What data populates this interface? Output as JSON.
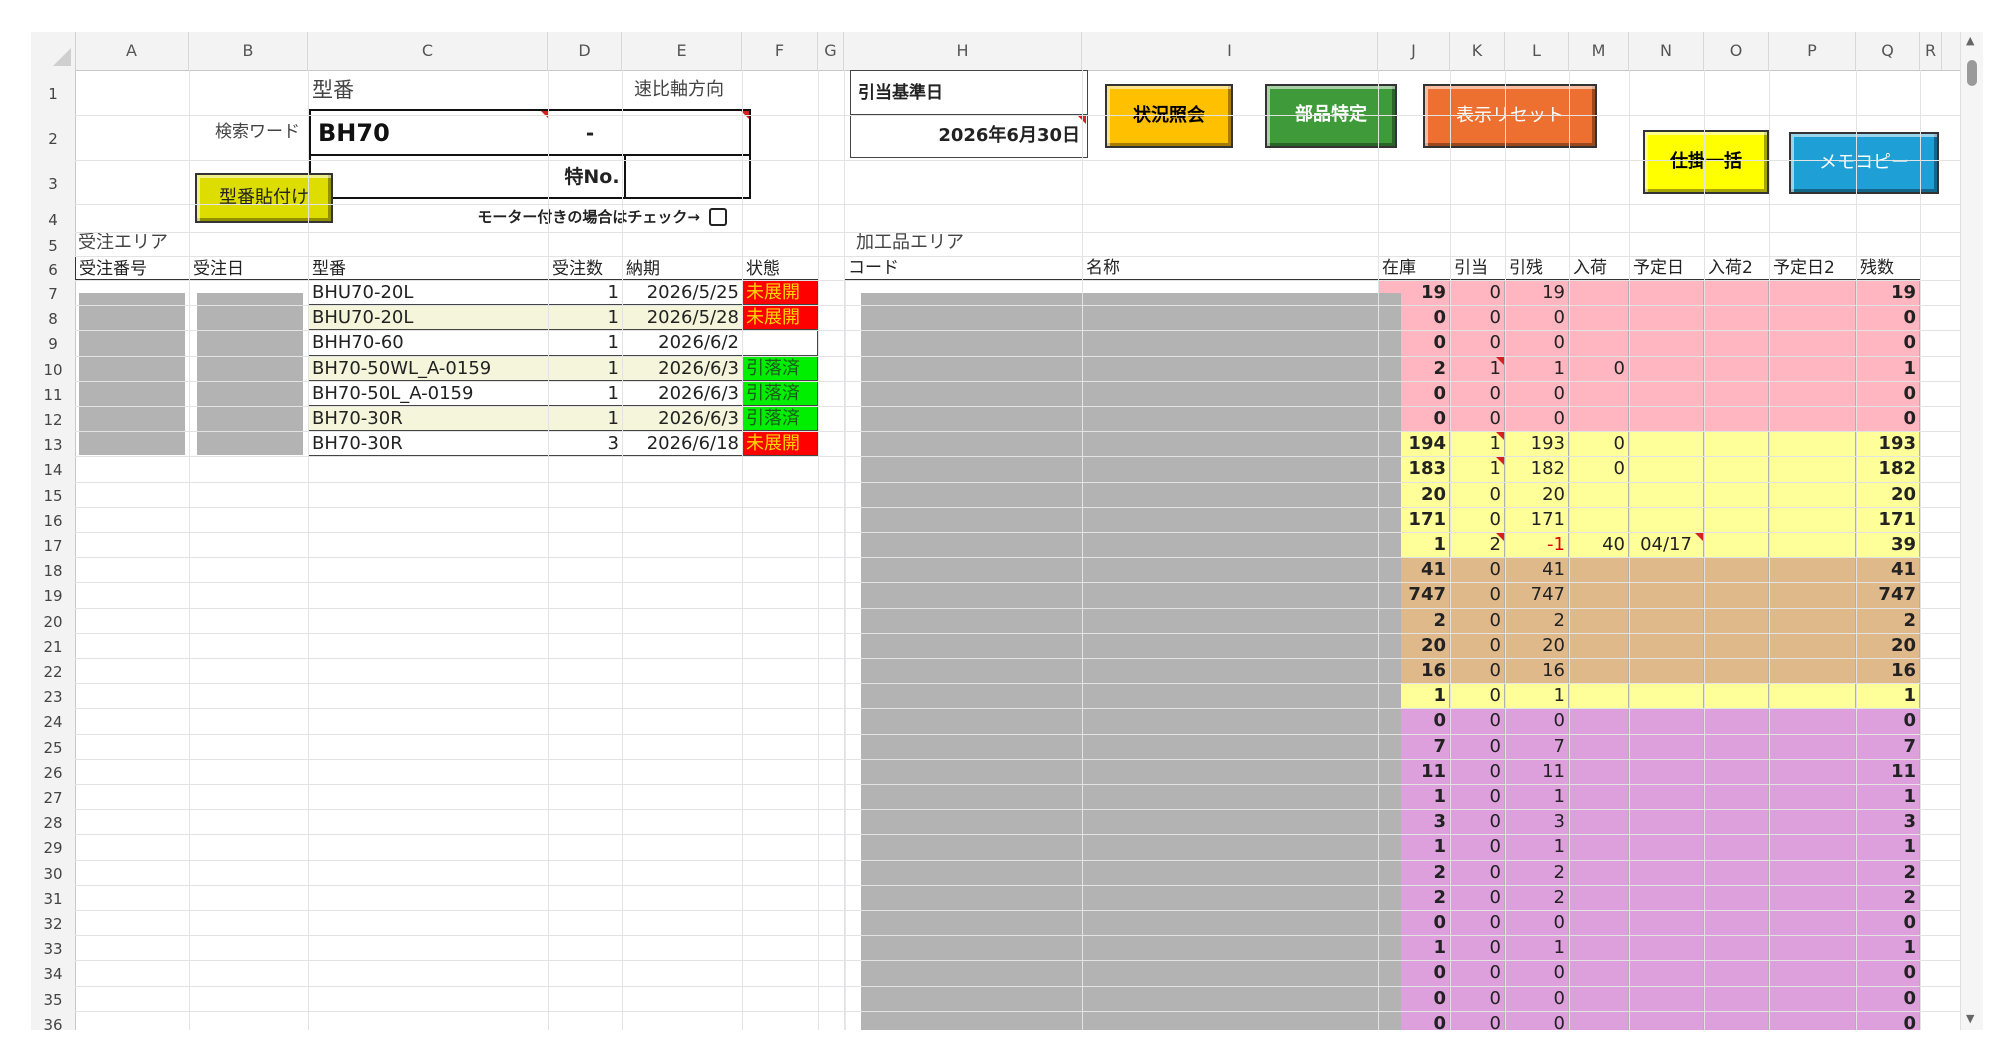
{
  "columns": [
    "A",
    "B",
    "C",
    "D",
    "E",
    "F",
    "G",
    "H",
    "I",
    "J",
    "K",
    "L",
    "M",
    "N",
    "O",
    "P",
    "Q",
    "R"
  ],
  "rows": [
    "1",
    "2",
    "3",
    "4",
    "5",
    "6",
    "7",
    "8",
    "9",
    "10",
    "11",
    "12",
    "13",
    "14",
    "15",
    "16",
    "17",
    "18",
    "19",
    "20",
    "21",
    "22",
    "23",
    "24",
    "25",
    "26",
    "27",
    "28",
    "29",
    "30",
    "31",
    "32",
    "33",
    "34",
    "35",
    "36"
  ],
  "labels": {
    "model_label": "型番",
    "ratio_axis_label": "速比軸方向",
    "search_word_label": "検索ワード",
    "search_value": "BH70",
    "dash": "-",
    "special_no_label": "特No.",
    "motor_check_label": "モーター付きの場合はチェック→",
    "order_area": "受注エリア",
    "processed_area": "加工品エリア",
    "ref_date_label": "引当基準日",
    "ref_date_value": "2026年6月30日"
  },
  "buttons": {
    "paste_model": "型番貼付け",
    "status_inquiry": "状況照会",
    "parts_identify": "部品特定",
    "reset_display": "表示リセット",
    "wip_batch": "仕掛一括",
    "memo_copy": "メモコピー"
  },
  "colors": {
    "unopened": "#ff0000",
    "allocated": "#00ee00",
    "pink": "#ffb6c1",
    "yellow": "#ffff99",
    "tan": "#e0b98a",
    "purple": "#dda0dd",
    "band": "#f5f5dc"
  },
  "order_headers": [
    "受注番号",
    "受注日",
    "型番",
    "受注数",
    "納期",
    "状態"
  ],
  "order_rows": [
    {
      "model": "BHU70-20L",
      "qty": "1",
      "due": "2026/5/25",
      "status": "未展開",
      "kind": "red"
    },
    {
      "model": "BHU70-20L",
      "qty": "1",
      "due": "2026/5/28",
      "status": "未展開",
      "kind": "red"
    },
    {
      "model": "BHH70-60",
      "qty": "1",
      "due": "2026/6/2",
      "status": "",
      "kind": "none"
    },
    {
      "model": "BH70-50WL_A-0159",
      "qty": "1",
      "due": "2026/6/3",
      "status": "引落済",
      "kind": "green"
    },
    {
      "model": "BH70-50L_A-0159",
      "qty": "1",
      "due": "2026/6/3",
      "status": "引落済",
      "kind": "green"
    },
    {
      "model": "BH70-30R",
      "qty": "1",
      "due": "2026/6/3",
      "status": "引落済",
      "kind": "green"
    },
    {
      "model": "BH70-30R",
      "qty": "3",
      "due": "2026/6/18",
      "status": "未展開",
      "kind": "red"
    }
  ],
  "stock_headers": [
    "コード",
    "名称",
    "在庫",
    "引当",
    "引残",
    "入荷",
    "予定日",
    "入荷2",
    "予定日2",
    "残数"
  ],
  "stock_rows": [
    {
      "stock": "19",
      "alloc": "0",
      "remain": "19",
      "arrival": "",
      "plan": "",
      "arrival2": "",
      "plan2": "",
      "balance": "19",
      "color": "pink"
    },
    {
      "stock": "0",
      "alloc": "0",
      "remain": "0",
      "arrival": "",
      "plan": "",
      "arrival2": "",
      "plan2": "",
      "balance": "0",
      "color": "pink"
    },
    {
      "stock": "0",
      "alloc": "0",
      "remain": "0",
      "arrival": "",
      "plan": "",
      "arrival2": "",
      "plan2": "",
      "balance": "0",
      "color": "pink"
    },
    {
      "stock": "2",
      "alloc": "1",
      "remain": "1",
      "arrival": "0",
      "plan": "",
      "arrival2": "",
      "plan2": "",
      "balance": "1",
      "color": "pink"
    },
    {
      "stock": "0",
      "alloc": "0",
      "remain": "0",
      "arrival": "",
      "plan": "",
      "arrival2": "",
      "plan2": "",
      "balance": "0",
      "color": "pink"
    },
    {
      "stock": "0",
      "alloc": "0",
      "remain": "0",
      "arrival": "",
      "plan": "",
      "arrival2": "",
      "plan2": "",
      "balance": "0",
      "color": "pink"
    },
    {
      "stock": "194",
      "alloc": "1",
      "remain": "193",
      "arrival": "0",
      "plan": "",
      "arrival2": "",
      "plan2": "",
      "balance": "193",
      "color": "yellow"
    },
    {
      "stock": "183",
      "alloc": "1",
      "remain": "182",
      "arrival": "0",
      "plan": "",
      "arrival2": "",
      "plan2": "",
      "balance": "182",
      "color": "yellow"
    },
    {
      "stock": "20",
      "alloc": "0",
      "remain": "20",
      "arrival": "",
      "plan": "",
      "arrival2": "",
      "plan2": "",
      "balance": "20",
      "color": "yellow"
    },
    {
      "stock": "171",
      "alloc": "0",
      "remain": "171",
      "arrival": "",
      "plan": "",
      "arrival2": "",
      "plan2": "",
      "balance": "171",
      "color": "yellow"
    },
    {
      "stock": "1",
      "alloc": "2",
      "remain": "-1",
      "arrival": "40",
      "plan": "04/17",
      "arrival2": "",
      "plan2": "",
      "balance": "39",
      "color": "yellow"
    },
    {
      "stock": "41",
      "alloc": "0",
      "remain": "41",
      "arrival": "",
      "plan": "",
      "arrival2": "",
      "plan2": "",
      "balance": "41",
      "color": "tan"
    },
    {
      "stock": "747",
      "alloc": "0",
      "remain": "747",
      "arrival": "",
      "plan": "",
      "arrival2": "",
      "plan2": "",
      "balance": "747",
      "color": "tan"
    },
    {
      "stock": "2",
      "alloc": "0",
      "remain": "2",
      "arrival": "",
      "plan": "",
      "arrival2": "",
      "plan2": "",
      "balance": "2",
      "color": "tan"
    },
    {
      "stock": "20",
      "alloc": "0",
      "remain": "20",
      "arrival": "",
      "plan": "",
      "arrival2": "",
      "plan2": "",
      "balance": "20",
      "color": "tan"
    },
    {
      "stock": "16",
      "alloc": "0",
      "remain": "16",
      "arrival": "",
      "plan": "",
      "arrival2": "",
      "plan2": "",
      "balance": "16",
      "color": "tan"
    },
    {
      "stock": "1",
      "alloc": "0",
      "remain": "1",
      "arrival": "",
      "plan": "",
      "arrival2": "",
      "plan2": "",
      "balance": "1",
      "color": "yellow"
    },
    {
      "stock": "0",
      "alloc": "0",
      "remain": "0",
      "arrival": "",
      "plan": "",
      "arrival2": "",
      "plan2": "",
      "balance": "0",
      "color": "purple"
    },
    {
      "stock": "7",
      "alloc": "0",
      "remain": "7",
      "arrival": "",
      "plan": "",
      "arrival2": "",
      "plan2": "",
      "balance": "7",
      "color": "purple"
    },
    {
      "stock": "11",
      "alloc": "0",
      "remain": "11",
      "arrival": "",
      "plan": "",
      "arrival2": "",
      "plan2": "",
      "balance": "11",
      "color": "purple"
    },
    {
      "stock": "1",
      "alloc": "0",
      "remain": "1",
      "arrival": "",
      "plan": "",
      "arrival2": "",
      "plan2": "",
      "balance": "1",
      "color": "purple"
    },
    {
      "stock": "3",
      "alloc": "0",
      "remain": "3",
      "arrival": "",
      "plan": "",
      "arrival2": "",
      "plan2": "",
      "balance": "3",
      "color": "purple"
    },
    {
      "stock": "1",
      "alloc": "0",
      "remain": "1",
      "arrival": "",
      "plan": "",
      "arrival2": "",
      "plan2": "",
      "balance": "1",
      "color": "purple"
    },
    {
      "stock": "2",
      "alloc": "0",
      "remain": "2",
      "arrival": "",
      "plan": "",
      "arrival2": "",
      "plan2": "",
      "balance": "2",
      "color": "purple"
    },
    {
      "stock": "2",
      "alloc": "0",
      "remain": "2",
      "arrival": "",
      "plan": "",
      "arrival2": "",
      "plan2": "",
      "balance": "2",
      "color": "purple"
    },
    {
      "stock": "0",
      "alloc": "0",
      "remain": "0",
      "arrival": "",
      "plan": "",
      "arrival2": "",
      "plan2": "",
      "balance": "0",
      "color": "purple"
    },
    {
      "stock": "1",
      "alloc": "0",
      "remain": "1",
      "arrival": "",
      "plan": "",
      "arrival2": "",
      "plan2": "",
      "balance": "1",
      "color": "purple"
    },
    {
      "stock": "0",
      "alloc": "0",
      "remain": "0",
      "arrival": "",
      "plan": "",
      "arrival2": "",
      "plan2": "",
      "balance": "0",
      "color": "purple"
    },
    {
      "stock": "0",
      "alloc": "0",
      "remain": "0",
      "arrival": "",
      "plan": "",
      "arrival2": "",
      "plan2": "",
      "balance": "0",
      "color": "purple"
    },
    {
      "stock": "0",
      "alloc": "0",
      "remain": "0",
      "arrival": "",
      "plan": "",
      "arrival2": "",
      "plan2": "",
      "balance": "0",
      "color": "purple"
    }
  ]
}
